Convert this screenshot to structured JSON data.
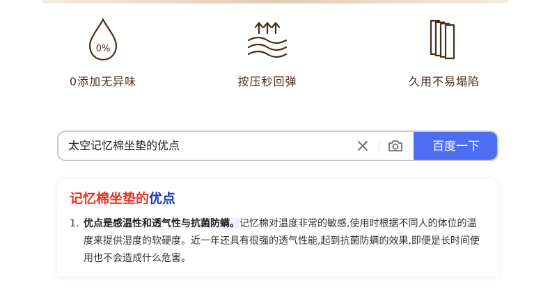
{
  "features": [
    {
      "icon": "drop-icon",
      "icon_text": "0%",
      "label": "0添加无异味"
    },
    {
      "icon": "rebound-icon",
      "label": "按压秒回弹"
    },
    {
      "icon": "layers-icon",
      "label": "久用不易塌陷"
    }
  ],
  "search": {
    "query": "太空记忆棉坐垫的优点",
    "button_label": "百度一下"
  },
  "result": {
    "title_red": "记忆棉坐垫的",
    "title_blue": "优点",
    "item_number": "1.",
    "item_bold": "优点是感温性和透气性与抗菌防螨。",
    "item_text": "记忆棉对温度非常的敏感,使用时根据不同人的体位的温度来提供湿度的软硬度。近一年还具有很强的透气性能,起到抗菌防螨的效果,即便是长时间使用也不会造成什么危害。"
  },
  "colors": {
    "brand_brown": "#4a2c1b",
    "button_blue": "#4e6ef2",
    "title_red": "#e8321f",
    "title_blue": "#1f3ab3"
  }
}
